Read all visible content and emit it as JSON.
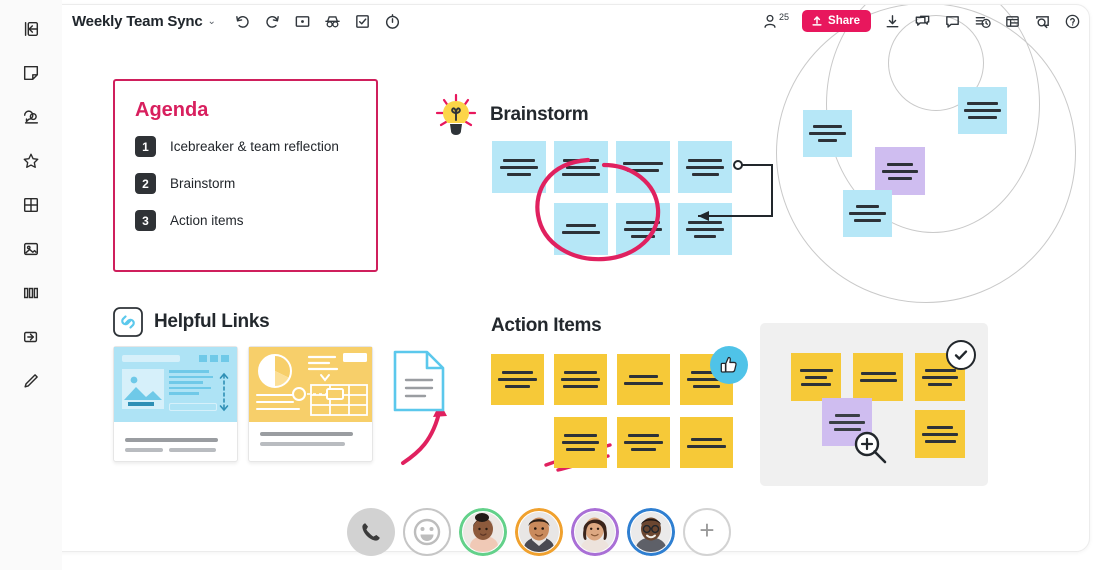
{
  "window": {
    "title": "Weekly Team Sync",
    "title_caret": "⌄"
  },
  "left_rail": {
    "items": [
      {
        "name": "collapse-panel-icon",
        "label": "Collapse panel"
      },
      {
        "name": "sticky-note-icon",
        "label": "Sticky note"
      },
      {
        "name": "comment-icon",
        "label": "Comment"
      },
      {
        "name": "star-icon",
        "label": "Star"
      },
      {
        "name": "grid-icon",
        "label": "Grid / table"
      },
      {
        "name": "image-icon",
        "label": "Image"
      },
      {
        "name": "columns-icon",
        "label": "Columns"
      },
      {
        "name": "frame-icon",
        "label": "Frame"
      },
      {
        "name": "pen-icon",
        "label": "Pen"
      }
    ]
  },
  "toolbar": {
    "icons": [
      {
        "name": "undo-icon",
        "label": "Undo"
      },
      {
        "name": "redo-icon",
        "label": "Redo"
      },
      {
        "name": "presentation-icon",
        "label": "Presentation mode"
      },
      {
        "name": "anonymous-icon",
        "label": "Anonymous mode"
      },
      {
        "name": "voting-icon",
        "label": "Voting"
      },
      {
        "name": "timer-icon",
        "label": "Timer"
      }
    ],
    "user_count": "25",
    "share_label": "Share",
    "right_icons": [
      {
        "name": "download-icon",
        "label": "Download"
      },
      {
        "name": "chat-icon",
        "label": "Chat"
      },
      {
        "name": "comments-icon",
        "label": "Comments"
      },
      {
        "name": "activity-icon",
        "label": "Activity"
      },
      {
        "name": "apps-icon",
        "label": "Apps"
      },
      {
        "name": "search-icon",
        "label": "Search"
      },
      {
        "name": "help-icon",
        "label": "Help"
      }
    ]
  },
  "agenda": {
    "title": "Agenda",
    "items": [
      {
        "num": "1",
        "label": "Icebreaker & team reflection"
      },
      {
        "num": "2",
        "label": "Brainstorm"
      },
      {
        "num": "3",
        "label": "Action items"
      }
    ]
  },
  "brainstorm": {
    "title": "Brainstorm",
    "icon": "lightbulb-icon",
    "note_count": 7
  },
  "helpful_links": {
    "title": "Helpful Links",
    "icon": "link-icon",
    "cards": [
      {
        "name": "link-preview-webpage",
        "color": "#aee3f5"
      },
      {
        "name": "link-preview-dashboard",
        "color": "#f7cf6a"
      }
    ],
    "document": {
      "name": "document-icon"
    }
  },
  "action_items": {
    "title": "Action Items",
    "note_count": 7,
    "reaction": {
      "name": "thumbs-up-reaction",
      "color": "#4fc3e8"
    }
  },
  "frame_group": {
    "badge": {
      "name": "check-badge"
    },
    "cursor": {
      "name": "zoom-in-cursor"
    },
    "note_count": 5
  },
  "collaborators": {
    "phone_label": "Phone",
    "emoji_label": "Reactions",
    "add_label": "+",
    "people": [
      {
        "name": "avatar-person-1",
        "ring": "#63d18a",
        "skin": "#8d5a3c",
        "hair": "#231a16",
        "shirt": "#f0c9b6"
      },
      {
        "name": "avatar-person-2",
        "ring": "#f0a12e",
        "skin": "#c98a5c",
        "hair": "#2a1d14",
        "shirt": "#4a4a52"
      },
      {
        "name": "avatar-person-3",
        "ring": "#a96fd6",
        "skin": "#dda882",
        "hair": "#3a241b",
        "shirt": "#ede3dc"
      },
      {
        "name": "avatar-person-4",
        "ring": "#2f7fd1",
        "skin": "#6b4630",
        "hair": "#1a1210",
        "shirt": "#5e6068"
      }
    ]
  },
  "colors": {
    "accent_pink": "#e8175d",
    "note_blue": "#b6e7f7",
    "note_yellow": "#f6c938",
    "note_purple": "#cfbdf0",
    "frame_gray": "#f0f0f0"
  }
}
